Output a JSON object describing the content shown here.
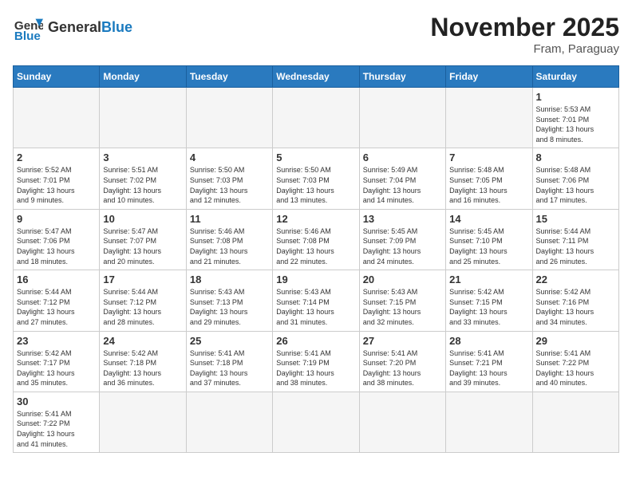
{
  "header": {
    "logo_general": "General",
    "logo_blue": "Blue",
    "month_title": "November 2025",
    "location": "Fram, Paraguay"
  },
  "weekdays": [
    "Sunday",
    "Monday",
    "Tuesday",
    "Wednesday",
    "Thursday",
    "Friday",
    "Saturday"
  ],
  "days": [
    {
      "date": "",
      "info": ""
    },
    {
      "date": "",
      "info": ""
    },
    {
      "date": "",
      "info": ""
    },
    {
      "date": "",
      "info": ""
    },
    {
      "date": "",
      "info": ""
    },
    {
      "date": "",
      "info": ""
    },
    {
      "date": "1",
      "info": "Sunrise: 5:53 AM\nSunset: 7:01 PM\nDaylight: 13 hours\nand 8 minutes."
    },
    {
      "date": "2",
      "info": "Sunrise: 5:52 AM\nSunset: 7:01 PM\nDaylight: 13 hours\nand 9 minutes."
    },
    {
      "date": "3",
      "info": "Sunrise: 5:51 AM\nSunset: 7:02 PM\nDaylight: 13 hours\nand 10 minutes."
    },
    {
      "date": "4",
      "info": "Sunrise: 5:50 AM\nSunset: 7:03 PM\nDaylight: 13 hours\nand 12 minutes."
    },
    {
      "date": "5",
      "info": "Sunrise: 5:50 AM\nSunset: 7:03 PM\nDaylight: 13 hours\nand 13 minutes."
    },
    {
      "date": "6",
      "info": "Sunrise: 5:49 AM\nSunset: 7:04 PM\nDaylight: 13 hours\nand 14 minutes."
    },
    {
      "date": "7",
      "info": "Sunrise: 5:48 AM\nSunset: 7:05 PM\nDaylight: 13 hours\nand 16 minutes."
    },
    {
      "date": "8",
      "info": "Sunrise: 5:48 AM\nSunset: 7:06 PM\nDaylight: 13 hours\nand 17 minutes."
    },
    {
      "date": "9",
      "info": "Sunrise: 5:47 AM\nSunset: 7:06 PM\nDaylight: 13 hours\nand 18 minutes."
    },
    {
      "date": "10",
      "info": "Sunrise: 5:47 AM\nSunset: 7:07 PM\nDaylight: 13 hours\nand 20 minutes."
    },
    {
      "date": "11",
      "info": "Sunrise: 5:46 AM\nSunset: 7:08 PM\nDaylight: 13 hours\nand 21 minutes."
    },
    {
      "date": "12",
      "info": "Sunrise: 5:46 AM\nSunset: 7:08 PM\nDaylight: 13 hours\nand 22 minutes."
    },
    {
      "date": "13",
      "info": "Sunrise: 5:45 AM\nSunset: 7:09 PM\nDaylight: 13 hours\nand 24 minutes."
    },
    {
      "date": "14",
      "info": "Sunrise: 5:45 AM\nSunset: 7:10 PM\nDaylight: 13 hours\nand 25 minutes."
    },
    {
      "date": "15",
      "info": "Sunrise: 5:44 AM\nSunset: 7:11 PM\nDaylight: 13 hours\nand 26 minutes."
    },
    {
      "date": "16",
      "info": "Sunrise: 5:44 AM\nSunset: 7:12 PM\nDaylight: 13 hours\nand 27 minutes."
    },
    {
      "date": "17",
      "info": "Sunrise: 5:44 AM\nSunset: 7:12 PM\nDaylight: 13 hours\nand 28 minutes."
    },
    {
      "date": "18",
      "info": "Sunrise: 5:43 AM\nSunset: 7:13 PM\nDaylight: 13 hours\nand 29 minutes."
    },
    {
      "date": "19",
      "info": "Sunrise: 5:43 AM\nSunset: 7:14 PM\nDaylight: 13 hours\nand 31 minutes."
    },
    {
      "date": "20",
      "info": "Sunrise: 5:43 AM\nSunset: 7:15 PM\nDaylight: 13 hours\nand 32 minutes."
    },
    {
      "date": "21",
      "info": "Sunrise: 5:42 AM\nSunset: 7:15 PM\nDaylight: 13 hours\nand 33 minutes."
    },
    {
      "date": "22",
      "info": "Sunrise: 5:42 AM\nSunset: 7:16 PM\nDaylight: 13 hours\nand 34 minutes."
    },
    {
      "date": "23",
      "info": "Sunrise: 5:42 AM\nSunset: 7:17 PM\nDaylight: 13 hours\nand 35 minutes."
    },
    {
      "date": "24",
      "info": "Sunrise: 5:42 AM\nSunset: 7:18 PM\nDaylight: 13 hours\nand 36 minutes."
    },
    {
      "date": "25",
      "info": "Sunrise: 5:41 AM\nSunset: 7:18 PM\nDaylight: 13 hours\nand 37 minutes."
    },
    {
      "date": "26",
      "info": "Sunrise: 5:41 AM\nSunset: 7:19 PM\nDaylight: 13 hours\nand 38 minutes."
    },
    {
      "date": "27",
      "info": "Sunrise: 5:41 AM\nSunset: 7:20 PM\nDaylight: 13 hours\nand 38 minutes."
    },
    {
      "date": "28",
      "info": "Sunrise: 5:41 AM\nSunset: 7:21 PM\nDaylight: 13 hours\nand 39 minutes."
    },
    {
      "date": "29",
      "info": "Sunrise: 5:41 AM\nSunset: 7:22 PM\nDaylight: 13 hours\nand 40 minutes."
    },
    {
      "date": "30",
      "info": "Sunrise: 5:41 AM\nSunset: 7:22 PM\nDaylight: 13 hours\nand 41 minutes."
    },
    {
      "date": "",
      "info": ""
    },
    {
      "date": "",
      "info": ""
    },
    {
      "date": "",
      "info": ""
    },
    {
      "date": "",
      "info": ""
    },
    {
      "date": "",
      "info": ""
    },
    {
      "date": "",
      "info": ""
    }
  ]
}
